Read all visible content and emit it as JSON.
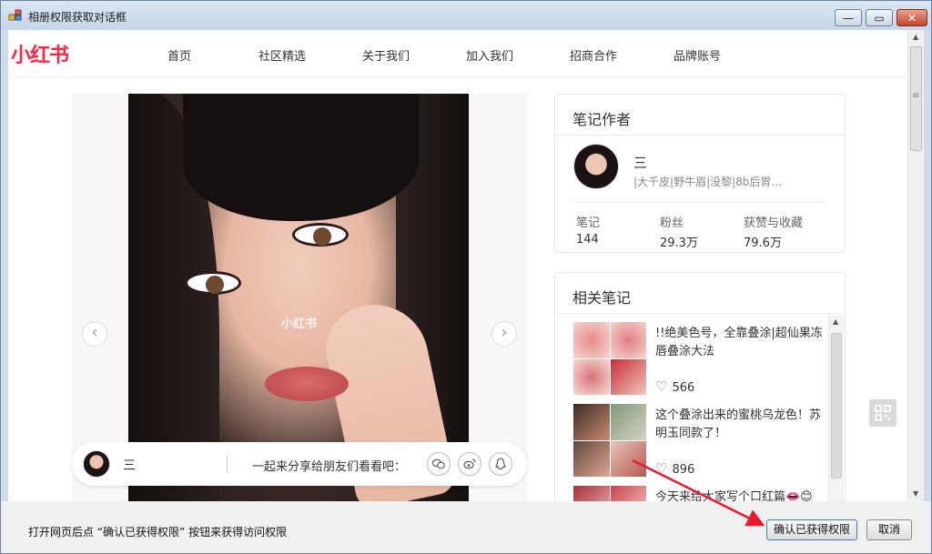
{
  "window": {
    "title": "相册权限获取对话框",
    "controls": {
      "minimize": "—",
      "maximize": "▭",
      "close": "✕"
    }
  },
  "site": {
    "logo": "小红书",
    "nav": [
      "首页",
      "社区精选",
      "关于我们",
      "加入我们",
      "招商合作",
      "品牌账号"
    ]
  },
  "gallery": {
    "watermark": "小红书",
    "prev": "‹",
    "next": "›"
  },
  "share_bar": {
    "user_name": "三",
    "text": "一起来分享给朋友们看看吧：",
    "icons": [
      "wechat-icon",
      "weibo-icon",
      "qq-icon"
    ]
  },
  "author_card": {
    "title": "笔记作者",
    "name": "三",
    "description": "|大千皮|野牛眉|没黎|8b后胃…",
    "stats": [
      {
        "label": "笔记",
        "value": "144"
      },
      {
        "label": "粉丝",
        "value": "29.3万"
      },
      {
        "label": "获赞与收藏",
        "value": "79.6万"
      }
    ]
  },
  "related_card": {
    "title": "相关笔记",
    "notes": [
      {
        "title": "!!绝美色号，全靠叠涂|超仙果冻唇叠涂大法",
        "likes": "566"
      },
      {
        "title": "这个叠涂出来的蜜桃乌龙色！苏明玉同款了！",
        "likes": "896"
      },
      {
        "title": "今天来给大家写个口红篇👄😊",
        "likes": ""
      }
    ]
  },
  "bottom": {
    "hint": "打开网页后点 “确认已获得权限” 按钮来获得访问权限",
    "ok_label": "确认已获得权限",
    "cancel_label": "取消"
  },
  "colors": {
    "brand": "#ff2442",
    "arrow": "#e8192c"
  }
}
